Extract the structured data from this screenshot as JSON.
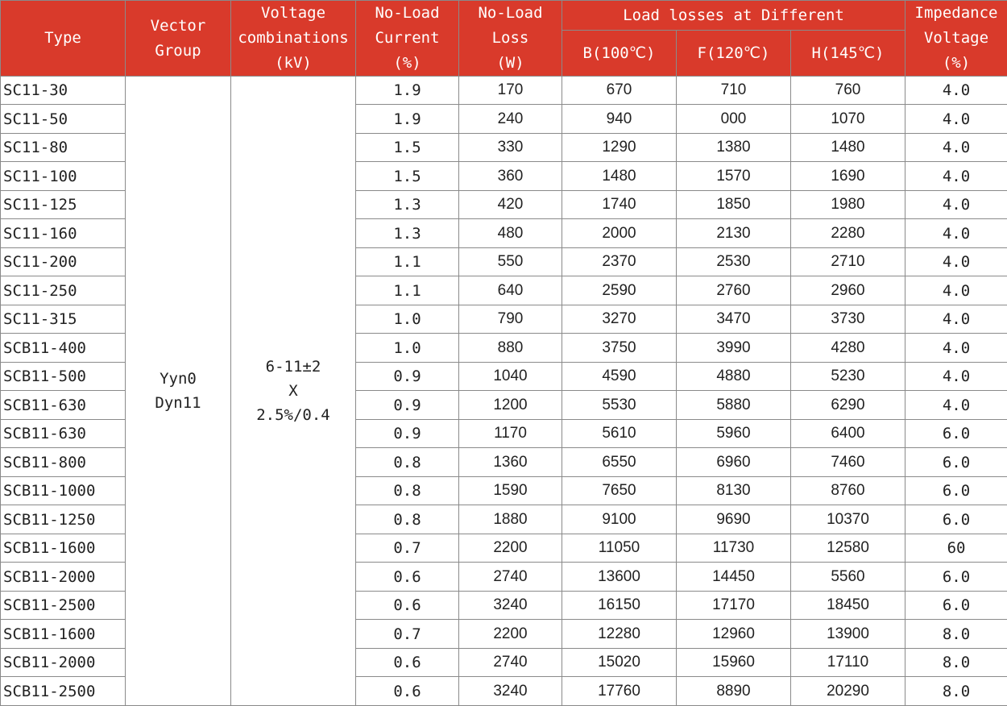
{
  "headers": {
    "type": "Type",
    "vector_group": "Vector\nGroup",
    "voltage": "Voltage\ncombinations\n(kV)",
    "no_load_current": "No-Load\nCurrent\n(%)",
    "no_load_loss": "No-Load\nLoss\n(W)",
    "load_losses": "Load losses at Different",
    "b": "B(100℃)",
    "f": "F(120℃)",
    "h": "H(145℃)",
    "impedance": "Impedance\nVoltage\n(%)"
  },
  "merged": {
    "vector_group": "Yyn0\nDyn11",
    "voltage": "6-11±2\nX\n2.5%/0.4"
  },
  "rows": [
    [
      "SC11-30",
      "1.9",
      "170",
      "670",
      "710",
      "760",
      "4.0"
    ],
    [
      "SC11-50",
      "1.9",
      "240",
      "940",
      "000",
      "1070",
      "4.0"
    ],
    [
      "SC11-80",
      "1.5",
      "330",
      "1290",
      "1380",
      "1480",
      "4.0"
    ],
    [
      "SC11-100",
      "1.5",
      "360",
      "1480",
      "1570",
      "1690",
      "4.0"
    ],
    [
      "SC11-125",
      "1.3",
      "420",
      "1740",
      "1850",
      "1980",
      "4.0"
    ],
    [
      "SC11-160",
      "1.3",
      "480",
      "2000",
      "2130",
      "2280",
      "4.0"
    ],
    [
      "SC11-200",
      "1.1",
      "550",
      "2370",
      "2530",
      "2710",
      "4.0"
    ],
    [
      "SC11-250",
      "1.1",
      "640",
      "2590",
      "2760",
      "2960",
      "4.0"
    ],
    [
      "SC11-315",
      "1.0",
      "790",
      "3270",
      "3470",
      "3730",
      "4.0"
    ],
    [
      "SCB11-400",
      "1.0",
      "880",
      "3750",
      "3990",
      "4280",
      "4.0"
    ],
    [
      "SCB11-500",
      "0.9",
      "1040",
      "4590",
      "4880",
      "5230",
      "4.0"
    ],
    [
      "SCB11-630",
      "0.9",
      "1200",
      "5530",
      "5880",
      "6290",
      "4.0"
    ],
    [
      "SCB11-630",
      "0.9",
      "1170",
      "5610",
      "5960",
      "6400",
      "6.0"
    ],
    [
      "SCB11-800",
      "0.8",
      "1360",
      "6550",
      "6960",
      "7460",
      "6.0"
    ],
    [
      "SCB11-1000",
      "0.8",
      "1590",
      "7650",
      "8130",
      "8760",
      "6.0"
    ],
    [
      "SCB11-1250",
      "0.8",
      "1880",
      "9100",
      "9690",
      "10370",
      "6.0"
    ],
    [
      "SCB11-1600",
      "0.7",
      "2200",
      "11050",
      "11730",
      "12580",
      "60"
    ],
    [
      "SCB11-2000",
      "0.6",
      "2740",
      "13600",
      "14450",
      "5560",
      "6.0"
    ],
    [
      "SCB11-2500",
      "0.6",
      "3240",
      "16150",
      "17170",
      "18450",
      "6.0"
    ],
    [
      "SCB11-1600",
      "0.7",
      "2200",
      "12280",
      "12960",
      "13900",
      "8.0"
    ],
    [
      "SCB11-2000",
      "0.6",
      "2740",
      "15020",
      "15960",
      "17110",
      "8.0"
    ],
    [
      "SCB11-2500",
      "0.6",
      "3240",
      "17760",
      "8890",
      "20290",
      "8.0"
    ]
  ]
}
